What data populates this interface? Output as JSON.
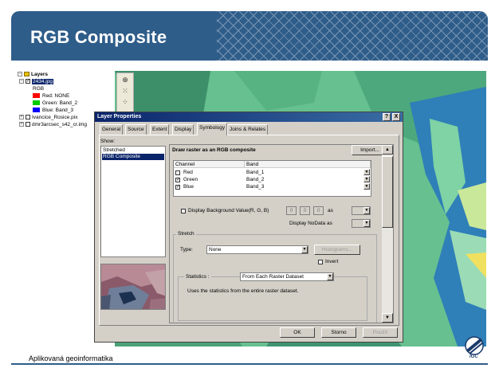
{
  "slide": {
    "title": "RGB Composite",
    "footer": "Aplikovaná geoinformatika",
    "logo_text": "IGC"
  },
  "toc": {
    "layers_label": "Layers",
    "layer_name": "2434.jpg",
    "rgb_label": "RGB",
    "red": "Red:   NONE",
    "green": "Green: Band_2",
    "blue": "Blue:  Band_3",
    "layer2": "Ivancice_Rosice.pix",
    "layer3": "dmr3arcsec_s42_cr.img"
  },
  "dialog": {
    "title": "Layer Properties",
    "help_btn": "?",
    "close_btn": "X",
    "tabs": [
      "General",
      "Source",
      "Extent",
      "Display",
      "Symbology",
      "Joins & Relates"
    ],
    "show_label": "Show:",
    "show_items": [
      "Stretched",
      "RGB Composite"
    ],
    "heading": "Draw raster as an RGB composite",
    "import_btn": "Import...",
    "table": {
      "col_channel": "Channel",
      "col_band": "Band",
      "rows": [
        {
          "channel": "Red",
          "band": "Band_1",
          "checked": false
        },
        {
          "channel": "Green",
          "band": "Band_2",
          "checked": true
        },
        {
          "channel": "Blue",
          "band": "Band_3",
          "checked": true
        }
      ]
    },
    "bg_value_label": "Display Background Value(R, G, B)",
    "bg_r": "0",
    "bg_g": "0",
    "bg_b": "0",
    "as_label": "as",
    "nodata_label": "Display NoData as",
    "stretch_group": "Stretch",
    "type_label": "Type:",
    "type_value": "None",
    "histograms_btn": "Histograms...",
    "invert_label": "Invert",
    "statistics_label": "Statistics :",
    "statistics_value": "From Each Raster Dataset",
    "statistics_desc": "Uses the statistics from the entire raster dataset.",
    "ok_btn": "OK",
    "cancel_btn": "Storno",
    "apply_btn": "Použít"
  },
  "colors": {
    "header": "#2f5d8a",
    "map_green": "#5fb98a",
    "map_blue": "#2f7fb8",
    "dialog_bg": "#d4d0c8",
    "titlebar": "#0a246a",
    "red_swatch": "#ff0000",
    "green_swatch": "#00cc00",
    "blue_swatch": "#0000ff"
  }
}
